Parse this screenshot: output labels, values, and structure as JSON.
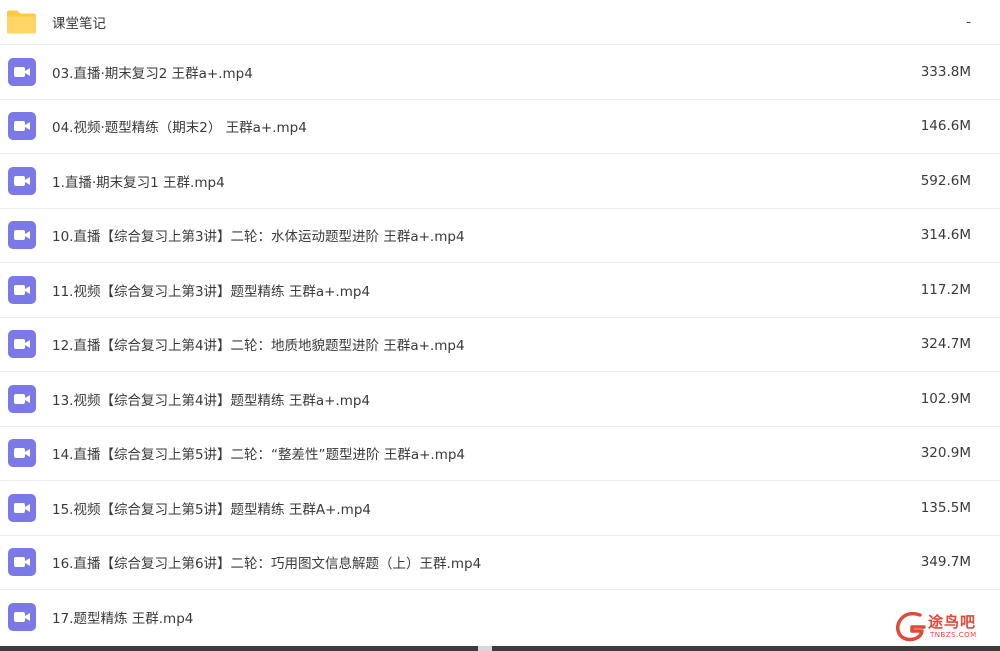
{
  "colors": {
    "video_icon": "#7b79e8",
    "folder_icon": "#ffc845",
    "watermark": "#e04a3a"
  },
  "files": [
    {
      "icon": "folder-icon",
      "name": "课堂笔记",
      "size": "-"
    },
    {
      "icon": "video-file-icon",
      "name": "03.直播·期末复习2 王群a+.mp4",
      "size": "333.8M"
    },
    {
      "icon": "video-file-icon",
      "name": "04.视频·题型精练（期末2） 王群a+.mp4",
      "size": "146.6M"
    },
    {
      "icon": "video-file-icon",
      "name": "1.直播·期末复习1 王群.mp4",
      "size": "592.6M"
    },
    {
      "icon": "video-file-icon",
      "name": "10.直播【综合复习上第3讲】二轮：水体运动题型进阶 王群a+.mp4",
      "size": "314.6M"
    },
    {
      "icon": "video-file-icon",
      "name": "11.视频【综合复习上第3讲】题型精练 王群a+.mp4",
      "size": "117.2M"
    },
    {
      "icon": "video-file-icon",
      "name": "12.直播【综合复习上第4讲】二轮：地质地貌题型进阶 王群a+.mp4",
      "size": "324.7M"
    },
    {
      "icon": "video-file-icon",
      "name": "13.视频【综合复习上第4讲】题型精练 王群a+.mp4",
      "size": "102.9M"
    },
    {
      "icon": "video-file-icon",
      "name": "14.直播【综合复习上第5讲】二轮：“整差性”题型进阶 王群a+.mp4",
      "size": "320.9M"
    },
    {
      "icon": "video-file-icon",
      "name": "15.视频【综合复习上第5讲】题型精练 王群A+.mp4",
      "size": "135.5M"
    },
    {
      "icon": "video-file-icon",
      "name": "16.直播【综合复习上第6讲】二轮：巧用图文信息解题（上）王群.mp4",
      "size": "349.7M"
    },
    {
      "icon": "video-file-icon",
      "name": "17.题型精炼 王群.mp4",
      "size": ""
    }
  ],
  "watermark": {
    "text": "途鸟吧",
    "subtext": "TNBZS.COM"
  }
}
